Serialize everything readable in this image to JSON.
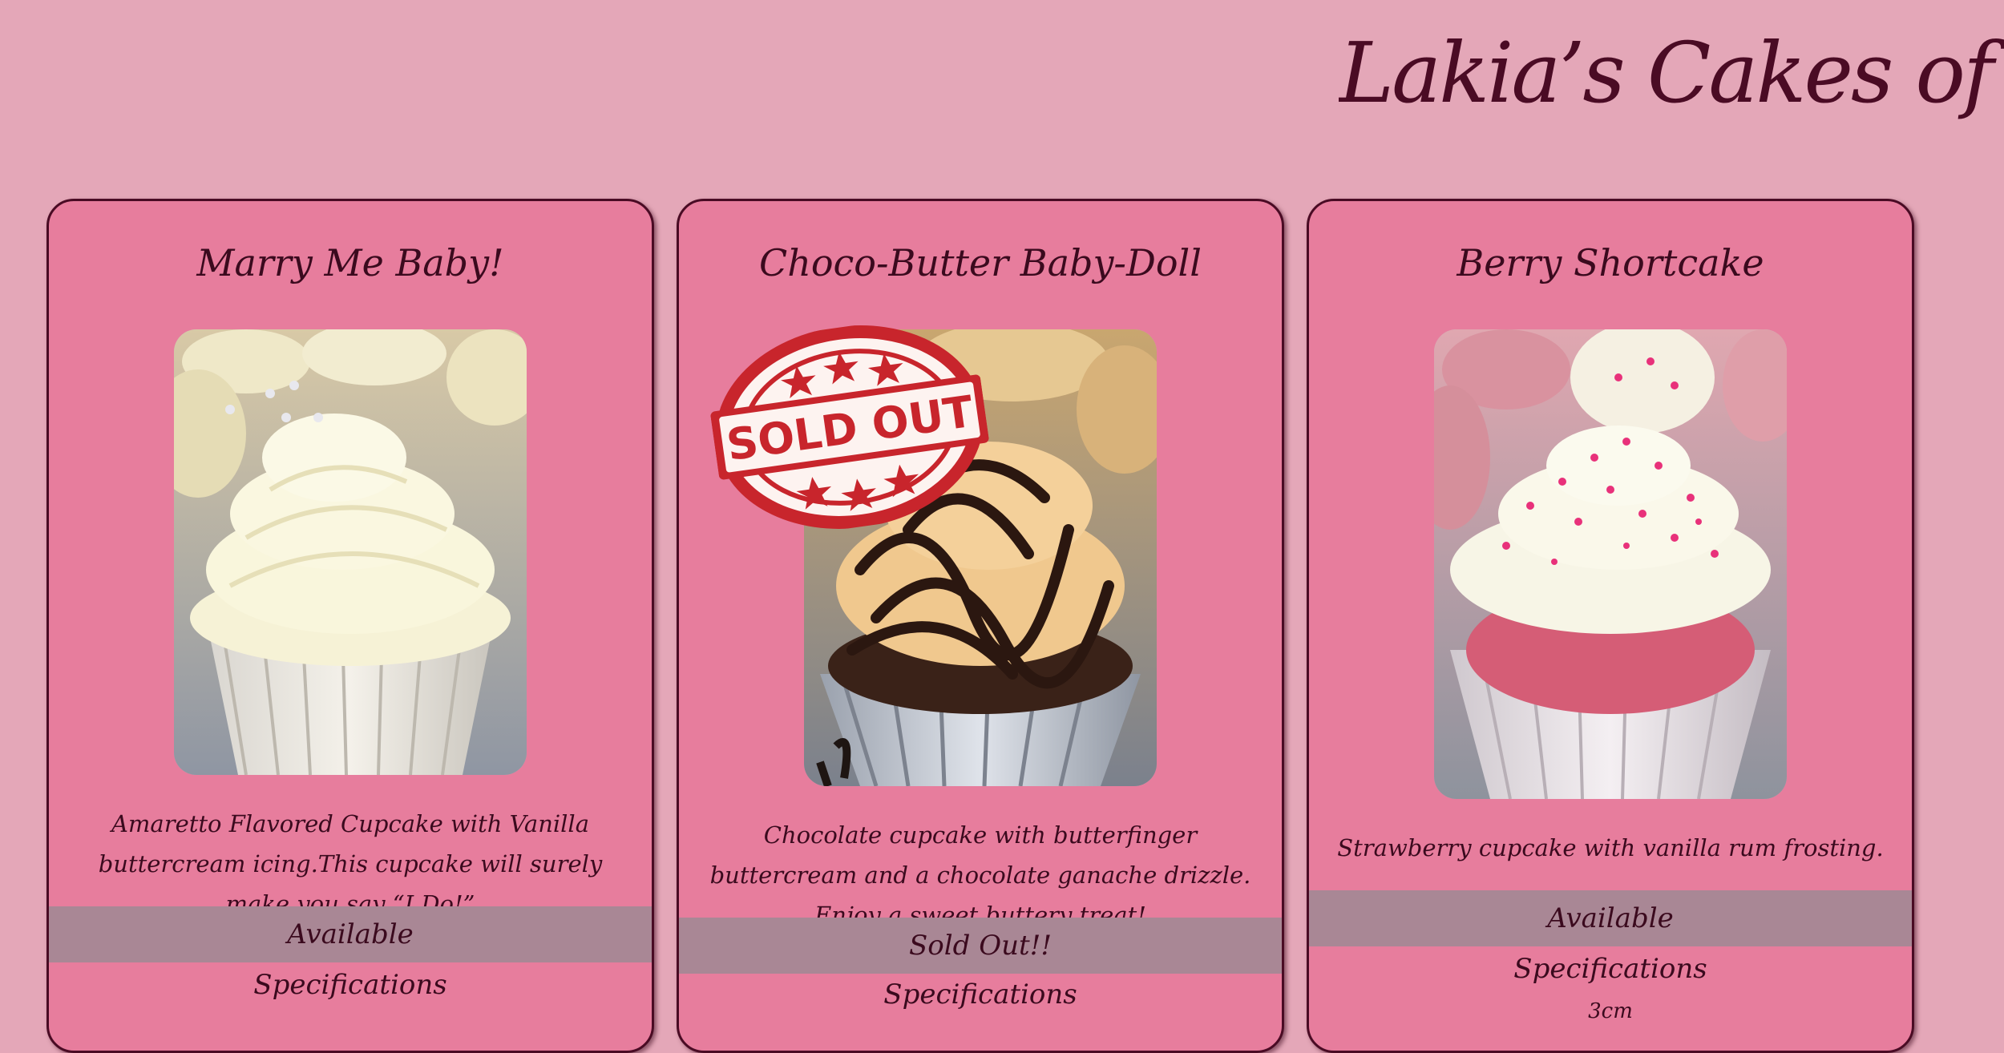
{
  "site": {
    "title": "Lakia’s Cakes of Cup"
  },
  "cards": [
    {
      "name": "Marry Me Baby!",
      "description": "Amaretto Flavored Cupcake with Vanilla buttercream icing.This cupcake will surely make you say “I Do!”",
      "status": "Available",
      "specs_label": "Specifications",
      "spec_value": ""
    },
    {
      "name": "Choco-Butter Baby-Doll",
      "description": "Chocolate cupcake with butterfinger buttercream and a chocolate ganache drizzle. Enjoy a sweet buttery treat!",
      "status": "Sold Out!!",
      "specs_label": "Specifications",
      "spec_value": "",
      "stamp_text": "SOLD OUT"
    },
    {
      "name": "Berry Shortcake",
      "description": "Strawberry cupcake with vanilla rum frosting.",
      "status": "Available",
      "specs_label": "Specifications",
      "spec_value": "3cm"
    }
  ],
  "colors": {
    "page_background": "#e4a7b8",
    "card_background": "#e77d9d",
    "card_border": "#4a0b24",
    "status_band": "#a98795",
    "text": "#3b0a1e",
    "stamp_red": "#c8252c"
  },
  "icons": {
    "stamp": "sold-out-stamp-icon"
  }
}
